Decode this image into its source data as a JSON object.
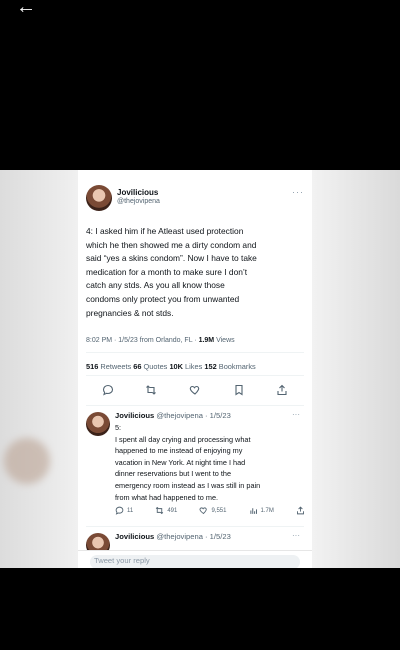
{
  "nav": {
    "back_icon": "arrow-left-icon",
    "back_glyph": "←"
  },
  "tweet": {
    "author_name": "Jovilicious",
    "author_handle": "@thejovipena",
    "more_glyph": "···",
    "body_lines": [
      "4: I asked him if he Atleast used protection",
      "which he then showed me a dirty condom and",
      "said “yes a skins condom”. Now I have to take",
      "medication  for a month to make sure I don’t",
      "catch any stds. As you all know those",
      "condoms only protect you from unwanted",
      "pregnancies & not stds."
    ],
    "meta": {
      "time_place": "8:02 PM · 1/5/23 from Orlando, FL · ",
      "views_count": "1.9M",
      "views_label": " Views"
    },
    "stats": {
      "retweets_count": "516",
      "retweets_label": " Retweets ",
      "quotes_count": "66",
      "quotes_label": " Quotes ",
      "likes_count": "10K",
      "likes_label": " Likes ",
      "bookmarks_count": "152",
      "bookmarks_label": " Bookmarks"
    }
  },
  "replies": [
    {
      "name": "Jovilicious",
      "handle_date": "@thejovipena · 1/5/23",
      "body_lines": [
        "5:",
        "I spent all day crying and processing what",
        "happened to me instead of enjoying my",
        "vacation in New York. At night time I had",
        "dinner reservations but I went to the",
        "emergency room instead as I was still in pain",
        "from what had happened to me."
      ],
      "actions": {
        "replies": "11",
        "retweets": "491",
        "likes": "9,551",
        "views": "1.7M"
      }
    },
    {
      "name": "Jovilicious",
      "handle_date": "@thejovipena · 1/5/23"
    }
  ],
  "compose": {
    "placeholder": "Tweet your reply"
  },
  "colors": {
    "accent": "#1d9bf0",
    "text": "#0f1419",
    "muted": "#536471"
  }
}
